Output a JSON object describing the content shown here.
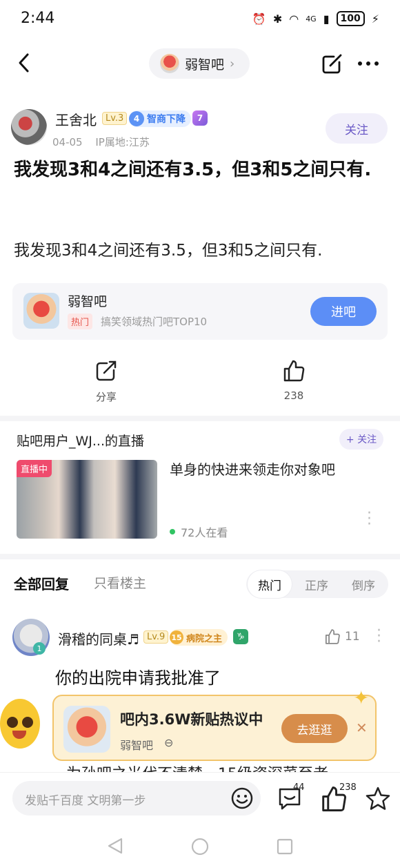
{
  "status_bar": {
    "time": "2:44",
    "battery": "100",
    "network": "4G"
  },
  "nav": {
    "forum_name": "弱智吧"
  },
  "post": {
    "author": "王舍北",
    "level": "Lv.3",
    "badge_num": "4",
    "badge_text": "智商下降",
    "purple_badge": "7",
    "date": "04-05",
    "ip": "IP属地:江苏",
    "follow_label": "关注",
    "title": "我发现3和4之间还有3.5，但3和5之间只有.",
    "body": "我发现3和4之间还有3.5，但3和5之间只有."
  },
  "forum_card": {
    "name": "弱智吧",
    "hot_tag": "热门",
    "subtitle": "搞笑领域热门吧TOP10",
    "enter_label": "进吧"
  },
  "actions": {
    "share_label": "分享",
    "like_count": "238"
  },
  "live": {
    "title": "贴吧用户_WJ...的直播",
    "follow_label": "+ 关注",
    "tag": "直播中",
    "caption": "单身的快进来领走你对象吧",
    "viewers": "72人在看"
  },
  "replies": {
    "tab_all": "全部回复",
    "tab_owner": "只看楼主",
    "sort_options": [
      "热门",
      "正序",
      "倒序"
    ],
    "active_sort": "热门"
  },
  "reply": {
    "name": "滑稽的同桌♬",
    "level": "Lv.9",
    "badge_num": "15",
    "badge_text": "病院之主",
    "zodiac": "♑",
    "avatar_level": "1",
    "likes": "11",
    "text": "你的出院申请我批准了",
    "cut_text": "为孙吧之光代不清楚，15级资深菜至老"
  },
  "promo": {
    "title": "吧内3.6W新贴热议中",
    "forum": "弱智吧",
    "go_label": "去逛逛"
  },
  "bottom_bar": {
    "placeholder": "发贴千百度 文明第一步",
    "comment_count": "44",
    "like_count": "238"
  }
}
